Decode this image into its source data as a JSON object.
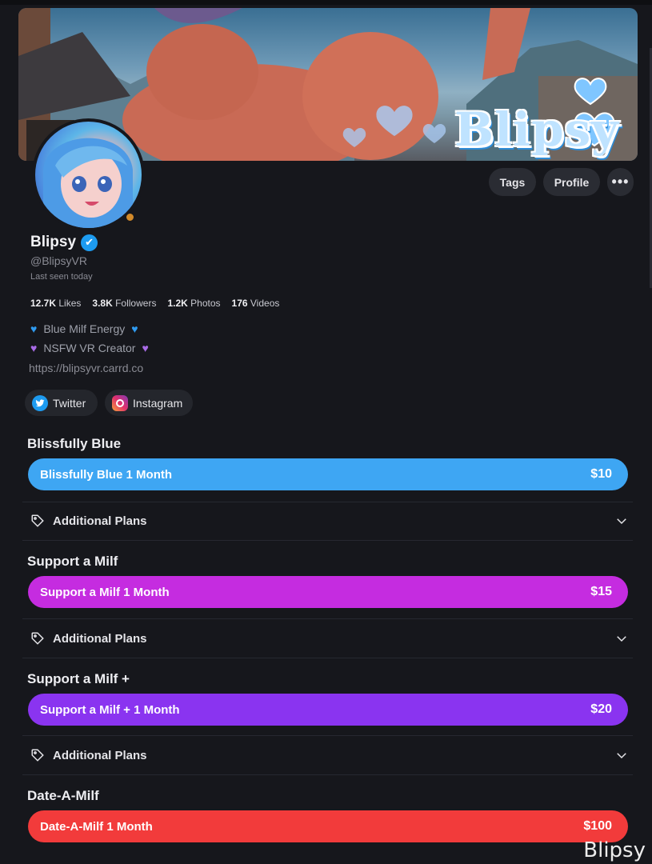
{
  "banner": {
    "logo_text": "Blipsy"
  },
  "header_actions": {
    "tags_label": "Tags",
    "profile_label": "Profile",
    "more_label": "•••"
  },
  "profile": {
    "name": "Blipsy",
    "verified_icon": "✔",
    "handle": "@BlipsyVR",
    "last_seen": "Last seen today",
    "stats": [
      {
        "value": "12.7K",
        "label": "Likes"
      },
      {
        "value": "3.8K",
        "label": "Followers"
      },
      {
        "value": "1.2K",
        "label": "Photos"
      },
      {
        "value": "176",
        "label": "Videos"
      }
    ],
    "bio": [
      {
        "text": "Blue Milf Energy",
        "heart_color": "#2f9bf0"
      },
      {
        "text": "NSFW VR Creator",
        "heart_color": "#a86be6"
      }
    ],
    "link": "https://blipsyvr.carrd.co"
  },
  "socials": [
    {
      "label": "Twitter",
      "icon": "twitter-icon"
    },
    {
      "label": "Instagram",
      "icon": "instagram-icon"
    }
  ],
  "tiers": [
    {
      "title": "Blissfully Blue",
      "plan": "Blissfully Blue 1 Month",
      "price": "$10",
      "color": "#3ea6f3",
      "additional_label": "Additional Plans"
    },
    {
      "title": "Support a Milf",
      "plan": "Support a Milf 1 Month",
      "price": "$15",
      "color": "#c52ce0",
      "additional_label": "Additional Plans"
    },
    {
      "title": "Support a Milf +",
      "plan": "Support a Milf + 1 Month",
      "price": "$20",
      "color": "#8a34f0",
      "additional_label": "Additional Plans"
    },
    {
      "title": "Date-A-Milf",
      "plan": "Date-A-Milf 1 Month",
      "price": "$100",
      "color": "#f23b3b"
    }
  ],
  "watermark": "Blipsy"
}
